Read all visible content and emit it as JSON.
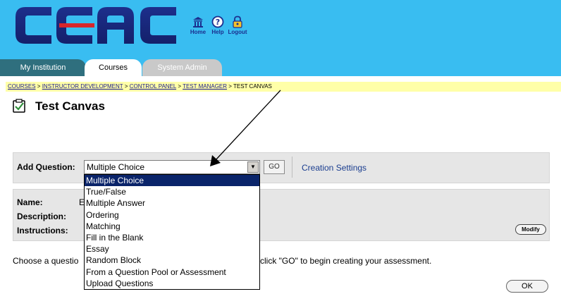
{
  "header": {
    "logo_text": "CCAC",
    "nav": [
      {
        "label": "Home",
        "icon": "home-icon"
      },
      {
        "label": "Help",
        "icon": "help-icon"
      },
      {
        "label": "Logout",
        "icon": "lock-icon"
      }
    ],
    "background_color": "#39bdf1"
  },
  "tabs": [
    {
      "label": "My Institution",
      "active": false
    },
    {
      "label": "Courses",
      "active": true
    },
    {
      "label": "System Admin",
      "active": false
    }
  ],
  "breadcrumb": {
    "items": [
      "COURSES",
      "INSTRUCTOR DEVELOPMENT",
      "CONTROL PANEL",
      "TEST MANAGER",
      "TEST CANVAS"
    ],
    "separator": ">"
  },
  "page": {
    "title": "Test Canvas",
    "title_icon": "checklist-icon"
  },
  "add_question": {
    "label": "Add Question:",
    "selected": "Multiple Choice",
    "go_label": "GO",
    "creation_settings_label": "Creation Settings",
    "options": [
      "Multiple Choice",
      "True/False",
      "Multiple Answer",
      "Ordering",
      "Matching",
      "Fill in the Blank",
      "Essay",
      "Random Block",
      "From a Question Pool or Assessment",
      "Upload Questions"
    ]
  },
  "info": {
    "name_label": "Name:",
    "name_value_visible": "E",
    "description_label": "Description:",
    "instructions_label": "Instructions:",
    "modify_label": "Modify"
  },
  "instruction": {
    "left_text": "Choose a questio",
    "right_text": "click \"GO\" to begin creating your assessment."
  },
  "ok_label": "OK",
  "colors": {
    "tab_my_institution": "#2f6f7e",
    "tab_system_admin": "#c9c9c9",
    "breadcrumb_bg": "#ffffa8",
    "panel_bg": "#e6e6e6",
    "selected_option_bg": "#0a246a"
  }
}
